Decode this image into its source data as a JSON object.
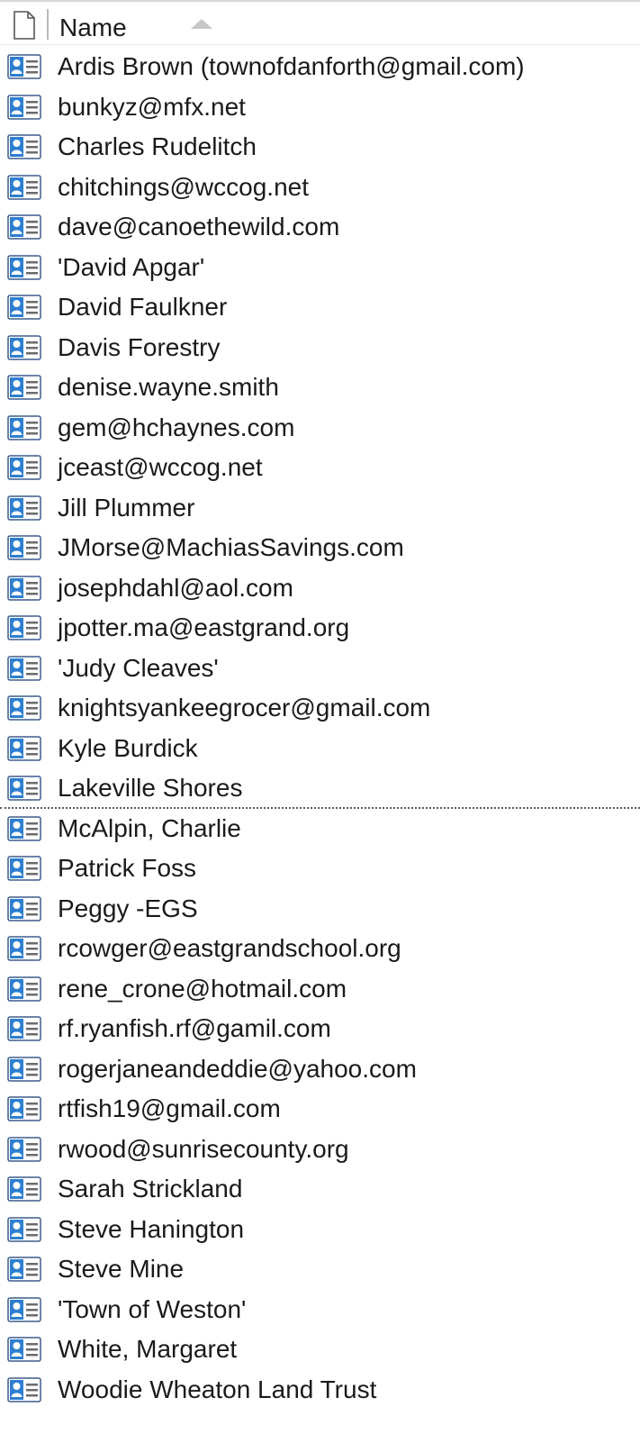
{
  "header": {
    "column_label": "Name",
    "sort_direction": "ascending"
  },
  "colors": {
    "icon_fill": "#2d7fd1",
    "icon_border": "#3d5c8c",
    "text": "#1a1a1a"
  },
  "contacts": [
    {
      "name": "Ardis Brown (townofdanforth@gmail.com)"
    },
    {
      "name": "bunkyz@mfx.net"
    },
    {
      "name": "Charles Rudelitch"
    },
    {
      "name": "chitchings@wccog.net"
    },
    {
      "name": "dave@canoethewild.com"
    },
    {
      "name": "'David Apgar'"
    },
    {
      "name": "David Faulkner"
    },
    {
      "name": "Davis Forestry"
    },
    {
      "name": "denise.wayne.smith"
    },
    {
      "name": "gem@hchaynes.com"
    },
    {
      "name": "jceast@wccog.net"
    },
    {
      "name": "Jill Plummer"
    },
    {
      "name": "JMorse@MachiasSavings.com"
    },
    {
      "name": "josephdahl@aol.com"
    },
    {
      "name": "jpotter.ma@eastgrand.org"
    },
    {
      "name": "'Judy Cleaves'"
    },
    {
      "name": "knightsyankeegrocer@gmail.com"
    },
    {
      "name": "Kyle Burdick"
    },
    {
      "name": "Lakeville Shores",
      "focused": true
    },
    {
      "name": "McAlpin, Charlie"
    },
    {
      "name": "Patrick Foss"
    },
    {
      "name": "Peggy -EGS"
    },
    {
      "name": "rcowger@eastgrandschool.org"
    },
    {
      "name": "rene_crone@hotmail.com"
    },
    {
      "name": "rf.ryanfish.rf@gamil.com"
    },
    {
      "name": "rogerjaneandeddie@yahoo.com"
    },
    {
      "name": "rtfish19@gmail.com"
    },
    {
      "name": "rwood@sunrisecounty.org"
    },
    {
      "name": "Sarah Strickland"
    },
    {
      "name": "Steve Hanington"
    },
    {
      "name": "Steve Mine"
    },
    {
      "name": "'Town of Weston'"
    },
    {
      "name": "White, Margaret"
    },
    {
      "name": "Woodie Wheaton Land Trust"
    }
  ]
}
